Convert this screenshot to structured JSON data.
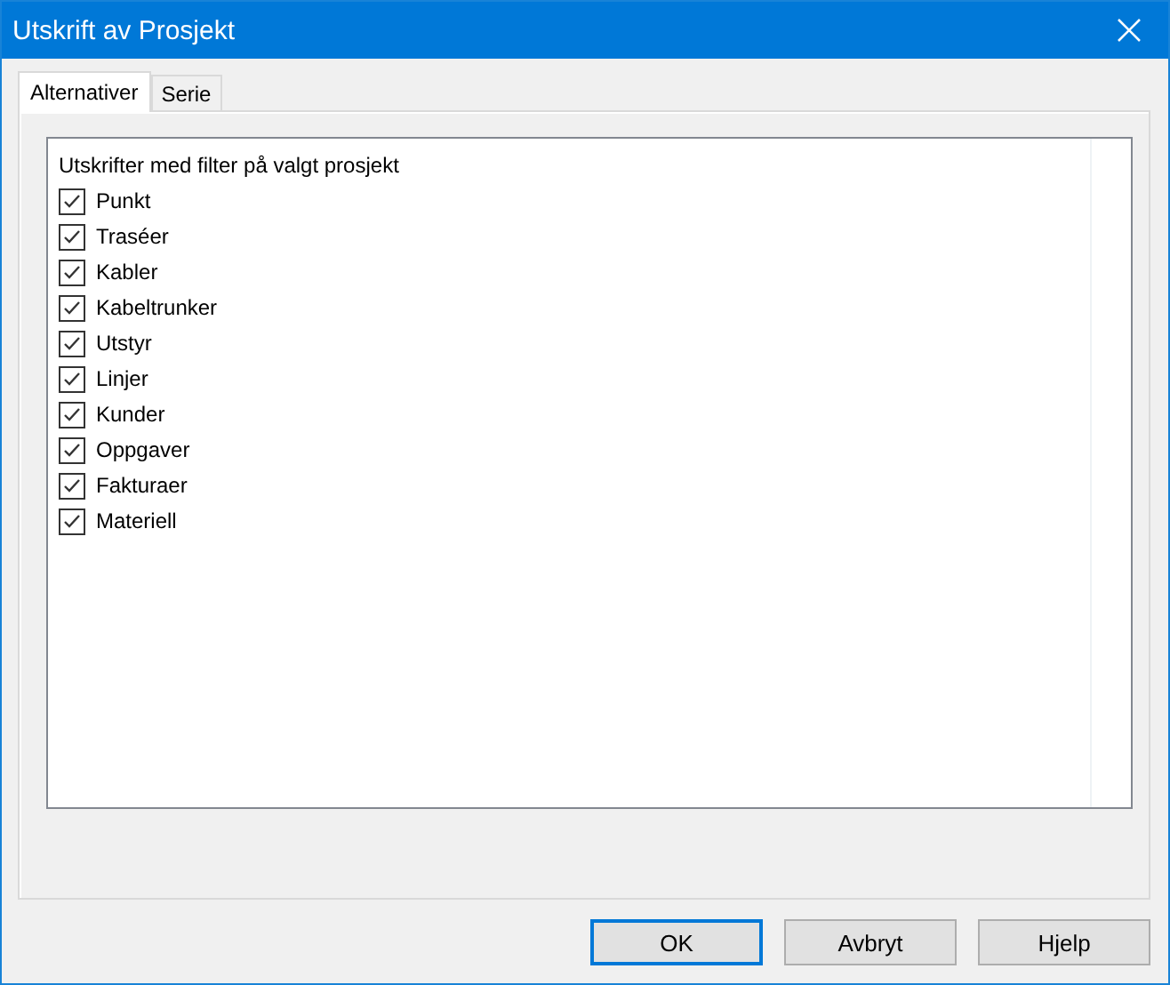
{
  "window": {
    "title": "Utskrift av Prosjekt"
  },
  "tabs": [
    {
      "label": "Alternativer",
      "selected": true
    },
    {
      "label": "Serie",
      "selected": false
    }
  ],
  "list": {
    "heading": "Utskrifter med filter på valgt prosjekt",
    "items": [
      {
        "label": "Punkt",
        "checked": true
      },
      {
        "label": "Traséer",
        "checked": true
      },
      {
        "label": "Kabler",
        "checked": true
      },
      {
        "label": "Kabeltrunker",
        "checked": true
      },
      {
        "label": "Utstyr",
        "checked": true
      },
      {
        "label": "Linjer",
        "checked": true
      },
      {
        "label": "Kunder",
        "checked": true
      },
      {
        "label": "Oppgaver",
        "checked": true
      },
      {
        "label": "Fakturaer",
        "checked": true
      },
      {
        "label": "Materiell",
        "checked": true
      }
    ]
  },
  "buttons": [
    {
      "label": "OK",
      "default": true
    },
    {
      "label": "Avbryt",
      "default": false
    },
    {
      "label": "Hjelp",
      "default": false
    }
  ]
}
